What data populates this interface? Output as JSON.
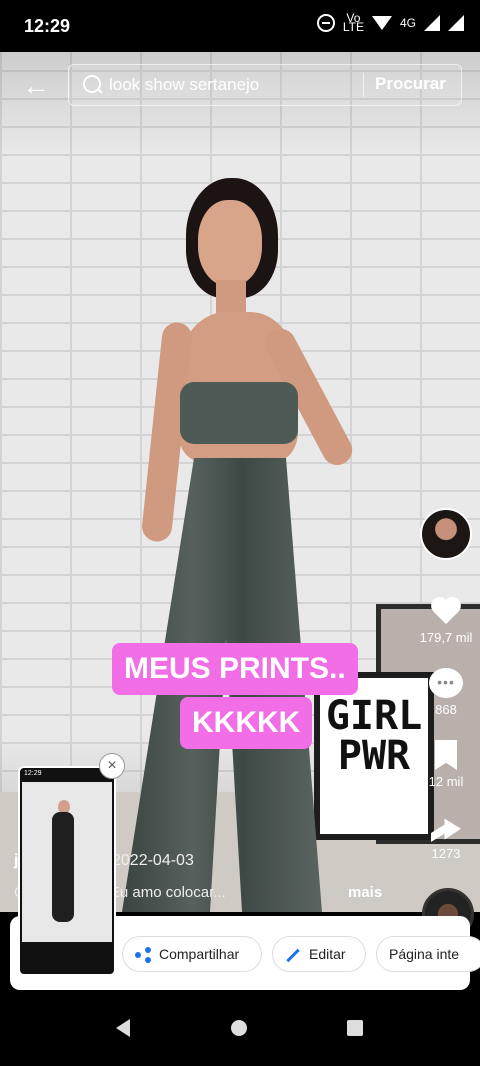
{
  "status_bar": {
    "time": "12:29",
    "volte": "Vo\nLTE",
    "network": "4G",
    "icons": [
      "do-not-disturb-icon",
      "volte-icon",
      "wifi-icon",
      "signal-icon",
      "battery-icon"
    ]
  },
  "search": {
    "query": "look show sertanejo",
    "button": "Procurar"
  },
  "caption": {
    "line1": "MEUS PRINTS..",
    "line2": "KKKKK"
  },
  "poster": {
    "text": "GIRL\nPWR"
  },
  "actions": {
    "likes": "179,7 mil",
    "comments": "868",
    "saves": "12 mil",
    "shares": "1273"
  },
  "video": {
    "user": "j",
    "date": "2022-04-03",
    "description": "C          escolheria? Eu amo colocar...",
    "more": "mais"
  },
  "share_sheet": {
    "share": "Compartilhar",
    "edit": "Editar",
    "full_page": "Página inte"
  },
  "colors": {
    "caption_bg": "#f16ee6",
    "accent": "#1a73e8"
  }
}
